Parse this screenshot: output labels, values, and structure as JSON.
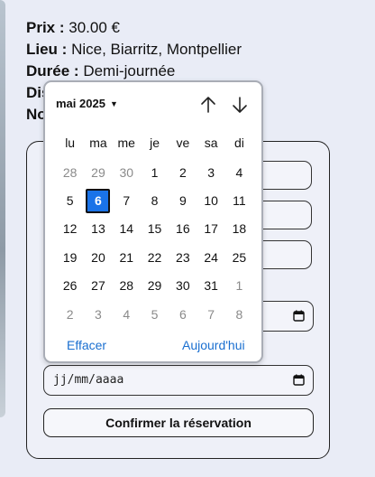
{
  "info": {
    "prix_label": "Prix :",
    "prix_value": "30.00 €",
    "lieu_label": "Lieu :",
    "lieu_value": "Nice, Biarritz, Montpellier",
    "duree_label": "Durée :",
    "duree_value": "Demi-journée",
    "line4_partial": "Dis",
    "line5_partial": "No"
  },
  "form": {
    "date_placeholder": "jj/mm/aaaa",
    "confirm_label": "Confirmer la réservation"
  },
  "datepicker": {
    "month_label": "mai 2025",
    "weekdays": [
      "lu",
      "ma",
      "me",
      "je",
      "ve",
      "sa",
      "di"
    ],
    "weeks": [
      [
        {
          "d": "28",
          "o": true
        },
        {
          "d": "29",
          "o": true
        },
        {
          "d": "30",
          "o": true
        },
        {
          "d": "1"
        },
        {
          "d": "2"
        },
        {
          "d": "3"
        },
        {
          "d": "4"
        }
      ],
      [
        {
          "d": "5"
        },
        {
          "d": "6",
          "sel": true
        },
        {
          "d": "7"
        },
        {
          "d": "8"
        },
        {
          "d": "9"
        },
        {
          "d": "10"
        },
        {
          "d": "11"
        }
      ],
      [
        {
          "d": "12"
        },
        {
          "d": "13"
        },
        {
          "d": "14"
        },
        {
          "d": "15"
        },
        {
          "d": "16"
        },
        {
          "d": "17"
        },
        {
          "d": "18"
        }
      ],
      [
        {
          "d": "19"
        },
        {
          "d": "20"
        },
        {
          "d": "21"
        },
        {
          "d": "22"
        },
        {
          "d": "23"
        },
        {
          "d": "24"
        },
        {
          "d": "25"
        }
      ],
      [
        {
          "d": "26"
        },
        {
          "d": "27"
        },
        {
          "d": "28"
        },
        {
          "d": "29"
        },
        {
          "d": "30"
        },
        {
          "d": "31"
        },
        {
          "d": "1",
          "o": true
        }
      ],
      [
        {
          "d": "2",
          "o": true
        },
        {
          "d": "3",
          "o": true
        },
        {
          "d": "4",
          "o": true
        },
        {
          "d": "5",
          "o": true
        },
        {
          "d": "6",
          "o": true
        },
        {
          "d": "7",
          "o": true
        },
        {
          "d": "8",
          "o": true
        }
      ]
    ],
    "selected_day": "6",
    "clear_label": "Effacer",
    "today_label": "Aujourd'hui",
    "accent_color": "#1a73e8",
    "icons": {
      "prev": "arrow-up-icon",
      "next": "arrow-down-icon",
      "calendar": "calendar-icon"
    }
  }
}
